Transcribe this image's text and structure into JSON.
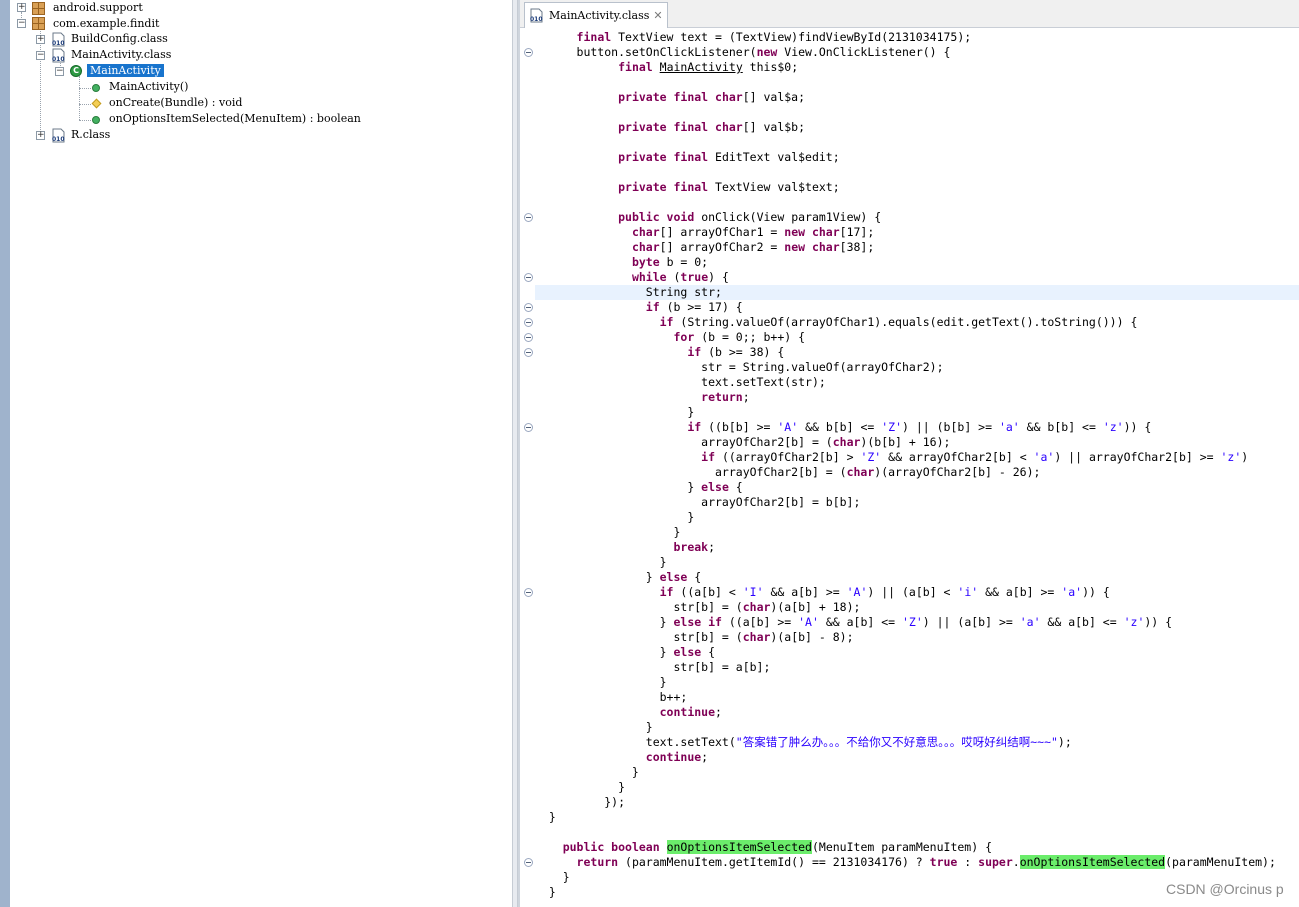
{
  "tree": {
    "items": [
      {
        "label": "android.support",
        "icon": "package-icon"
      },
      {
        "label": "com.example.findit",
        "icon": "package-icon"
      },
      {
        "label": "BuildConfig.class",
        "icon": "class-file-icon"
      },
      {
        "label": "MainActivity.class",
        "icon": "class-file-icon"
      },
      {
        "label": "MainActivity",
        "icon": "class-icon",
        "selected": true
      },
      {
        "label": "MainActivity()",
        "icon": "public-method-icon"
      },
      {
        "label": "onCreate(Bundle) : void",
        "icon": "protected-method-icon"
      },
      {
        "label": "onOptionsItemSelected(MenuItem) : boolean",
        "icon": "public-method-icon"
      },
      {
        "label": "R.class",
        "icon": "class-file-icon"
      }
    ],
    "toggles": {
      "expand": "+",
      "collapse": "−"
    }
  },
  "editor": {
    "tab_title": "MainActivity.class",
    "tab_close": "✕",
    "code_lines": [
      [
        [
          "      ",
          ""
        ],
        [
          "final",
          "kw"
        ],
        [
          " TextView text = (TextView)findViewById(2131034175);",
          ""
        ]
      ],
      [
        [
          "      button.setOnClickListener(",
          ""
        ],
        [
          "new",
          "kw"
        ],
        [
          " View.OnClickListener() {",
          ""
        ]
      ],
      [
        [
          "            ",
          ""
        ],
        [
          "final",
          "kw"
        ],
        [
          " ",
          ""
        ],
        [
          "MainActivity",
          "u"
        ],
        [
          " this$0;",
          ""
        ]
      ],
      [
        [
          "",
          ""
        ]
      ],
      [
        [
          "            ",
          ""
        ],
        [
          "private final char",
          "kw"
        ],
        [
          "[] val$a;",
          ""
        ]
      ],
      [
        [
          "",
          ""
        ]
      ],
      [
        [
          "            ",
          ""
        ],
        [
          "private final char",
          "kw"
        ],
        [
          "[] val$b;",
          ""
        ]
      ],
      [
        [
          "",
          ""
        ]
      ],
      [
        [
          "            ",
          ""
        ],
        [
          "private final",
          "kw"
        ],
        [
          " EditText val$edit;",
          ""
        ]
      ],
      [
        [
          "",
          ""
        ]
      ],
      [
        [
          "            ",
          ""
        ],
        [
          "private final",
          "kw"
        ],
        [
          " TextView val$text;",
          ""
        ]
      ],
      [
        [
          "",
          ""
        ]
      ],
      [
        [
          "            ",
          ""
        ],
        [
          "public void",
          "kw"
        ],
        [
          " onClick(View param1View) {",
          ""
        ]
      ],
      [
        [
          "              ",
          ""
        ],
        [
          "char",
          "kw"
        ],
        [
          "[] arrayOfChar1 = ",
          ""
        ],
        [
          "new char",
          "kw"
        ],
        [
          "[17];",
          ""
        ]
      ],
      [
        [
          "              ",
          ""
        ],
        [
          "char",
          "kw"
        ],
        [
          "[] arrayOfChar2 = ",
          ""
        ],
        [
          "new char",
          "kw"
        ],
        [
          "[38];",
          ""
        ]
      ],
      [
        [
          "              ",
          ""
        ],
        [
          "byte",
          "kw"
        ],
        [
          " b = 0;",
          ""
        ]
      ],
      [
        [
          "              ",
          ""
        ],
        [
          "while",
          "kw"
        ],
        [
          " (",
          ""
        ],
        [
          "true",
          "kw"
        ],
        [
          ") {",
          ""
        ]
      ],
      [
        [
          "                String str;",
          ""
        ]
      ],
      [
        [
          "                ",
          ""
        ],
        [
          "if",
          "kw"
        ],
        [
          " (b >= 17) {",
          ""
        ]
      ],
      [
        [
          "                  ",
          ""
        ],
        [
          "if",
          "kw"
        ],
        [
          " (String.valueOf(arrayOfChar1).equals(edit.getText().toString())) {",
          ""
        ]
      ],
      [
        [
          "                    ",
          ""
        ],
        [
          "for",
          "kw"
        ],
        [
          " (b = 0;; b++) {",
          ""
        ]
      ],
      [
        [
          "                      ",
          ""
        ],
        [
          "if",
          "kw"
        ],
        [
          " (b >= 38) {",
          ""
        ]
      ],
      [
        [
          "                        str = String.valueOf(arrayOfChar2);",
          ""
        ]
      ],
      [
        [
          "                        text.setText(str);",
          ""
        ]
      ],
      [
        [
          "                        ",
          ""
        ],
        [
          "return",
          "kw"
        ],
        [
          ";",
          ""
        ]
      ],
      [
        [
          "                      }",
          ""
        ]
      ],
      [
        [
          "                      ",
          ""
        ],
        [
          "if",
          "kw"
        ],
        [
          " ((b[b] >= ",
          ""
        ],
        [
          "'A'",
          "str"
        ],
        [
          " && b[b] <= ",
          ""
        ],
        [
          "'Z'",
          "str"
        ],
        [
          ") || (b[b] >= ",
          ""
        ],
        [
          "'a'",
          "str"
        ],
        [
          " && b[b] <= ",
          ""
        ],
        [
          "'z'",
          "str"
        ],
        [
          ")) {",
          ""
        ]
      ],
      [
        [
          "                        arrayOfChar2[b] = (",
          ""
        ],
        [
          "char",
          "kw"
        ],
        [
          ")(b[b] + 16);",
          ""
        ]
      ],
      [
        [
          "                        ",
          ""
        ],
        [
          "if",
          "kw"
        ],
        [
          " ((arrayOfChar2[b] > ",
          ""
        ],
        [
          "'Z'",
          "str"
        ],
        [
          " && arrayOfChar2[b] < ",
          ""
        ],
        [
          "'a'",
          "str"
        ],
        [
          ") || arrayOfChar2[b] >= ",
          ""
        ],
        [
          "'z'",
          "str"
        ],
        [
          ")",
          ""
        ]
      ],
      [
        [
          "                          arrayOfChar2[b] = (",
          ""
        ],
        [
          "char",
          "kw"
        ],
        [
          ")(arrayOfChar2[b] - 26);",
          ""
        ]
      ],
      [
        [
          "                      } ",
          ""
        ],
        [
          "else",
          "kw"
        ],
        [
          " {",
          ""
        ]
      ],
      [
        [
          "                        arrayOfChar2[b] = b[b];",
          ""
        ]
      ],
      [
        [
          "                      }",
          ""
        ]
      ],
      [
        [
          "                    }",
          ""
        ]
      ],
      [
        [
          "                    ",
          ""
        ],
        [
          "break",
          "kw"
        ],
        [
          ";",
          ""
        ]
      ],
      [
        [
          "                  }",
          ""
        ]
      ],
      [
        [
          "                } ",
          ""
        ],
        [
          "else",
          "kw"
        ],
        [
          " {",
          ""
        ]
      ],
      [
        [
          "                  ",
          ""
        ],
        [
          "if",
          "kw"
        ],
        [
          " ((a[b] < ",
          ""
        ],
        [
          "'I'",
          "str"
        ],
        [
          " && a[b] >= ",
          ""
        ],
        [
          "'A'",
          "str"
        ],
        [
          ") || (a[b] < ",
          ""
        ],
        [
          "'i'",
          "str"
        ],
        [
          " && a[b] >= ",
          ""
        ],
        [
          "'a'",
          "str"
        ],
        [
          ")) {",
          ""
        ]
      ],
      [
        [
          "                    str[b] = (",
          ""
        ],
        [
          "char",
          "kw"
        ],
        [
          ")(a[b] + 18);",
          ""
        ]
      ],
      [
        [
          "                  } ",
          ""
        ],
        [
          "else if",
          "kw"
        ],
        [
          " ((a[b] >= ",
          ""
        ],
        [
          "'A'",
          "str"
        ],
        [
          " && a[b] <= ",
          ""
        ],
        [
          "'Z'",
          "str"
        ],
        [
          ") || (a[b] >= ",
          ""
        ],
        [
          "'a'",
          "str"
        ],
        [
          " && a[b] <= ",
          ""
        ],
        [
          "'z'",
          "str"
        ],
        [
          ")) {",
          ""
        ]
      ],
      [
        [
          "                    str[b] = (",
          ""
        ],
        [
          "char",
          "kw"
        ],
        [
          ")(a[b] - 8);",
          ""
        ]
      ],
      [
        [
          "                  } ",
          ""
        ],
        [
          "else",
          "kw"
        ],
        [
          " {",
          ""
        ]
      ],
      [
        [
          "                    str[b] = a[b];",
          ""
        ]
      ],
      [
        [
          "                  }",
          ""
        ]
      ],
      [
        [
          "                  b++;",
          ""
        ]
      ],
      [
        [
          "                  ",
          ""
        ],
        [
          "continue",
          "kw"
        ],
        [
          ";",
          ""
        ]
      ],
      [
        [
          "                }",
          ""
        ]
      ],
      [
        [
          "                text.setText(",
          ""
        ],
        [
          "\"答案错了肿么办。。。不给你又不好意思。。。哎呀好纠结啊~~~\"",
          "str"
        ],
        [
          ");",
          ""
        ]
      ],
      [
        [
          "                ",
          ""
        ],
        [
          "continue",
          "kw"
        ],
        [
          ";",
          ""
        ]
      ],
      [
        [
          "              }",
          ""
        ]
      ],
      [
        [
          "            }",
          ""
        ]
      ],
      [
        [
          "          });",
          ""
        ]
      ],
      [
        [
          "  }",
          ""
        ]
      ],
      [
        [
          "",
          ""
        ]
      ],
      [
        [
          "    ",
          ""
        ],
        [
          "public boolean",
          "kw"
        ],
        [
          " ",
          ""
        ],
        [
          "onOptionsItemSelected",
          "hl"
        ],
        [
          "(MenuItem paramMenuItem) {",
          ""
        ]
      ],
      [
        [
          "      ",
          ""
        ],
        [
          "return",
          "kw"
        ],
        [
          " (paramMenuItem.getItemId() == 2131034176) ? ",
          ""
        ],
        [
          "true",
          "kw"
        ],
        [
          " : ",
          ""
        ],
        [
          "super",
          "kw"
        ],
        [
          ".",
          ""
        ],
        [
          "onOptionsItemSelected",
          "hl"
        ],
        [
          "(paramMenuItem);",
          ""
        ]
      ],
      [
        [
          "    }",
          ""
        ]
      ],
      [
        [
          "  }",
          ""
        ]
      ]
    ],
    "current_line_index": 17,
    "fold_markers": [
      1,
      12,
      16,
      18,
      19,
      20,
      21,
      26,
      37,
      55
    ]
  },
  "watermark": "CSDN @Orcinus p",
  "colors": {
    "keyword": "#7f0055",
    "string": "#2a00ff",
    "selection": "#1874cd",
    "highlight": "#6bed6b",
    "current_line": "#e8f2fe"
  }
}
